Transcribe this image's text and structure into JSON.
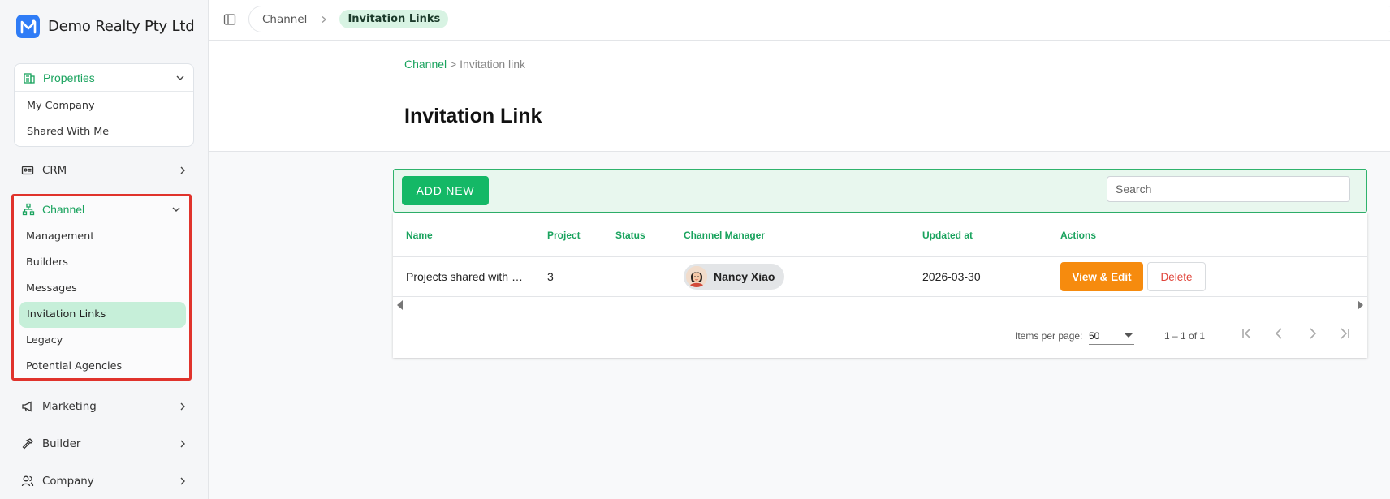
{
  "brand": {
    "name": "Demo Realty Pty Ltd",
    "logo_icon": "m-logo-icon",
    "logo_color": "#2f7cf6"
  },
  "sidebar": {
    "properties": {
      "label": "Properties",
      "items": [
        "My Company",
        "Shared With Me"
      ]
    },
    "crm": {
      "label": "CRM"
    },
    "channel": {
      "label": "Channel",
      "items": [
        "Management",
        "Builders",
        "Messages",
        "Invitation Links",
        "Legacy",
        "Potential Agencies"
      ],
      "active": "Invitation Links"
    },
    "marketing": {
      "label": "Marketing"
    },
    "builder": {
      "label": "Builder"
    },
    "company": {
      "label": "Company"
    }
  },
  "topbar": {
    "crumb_root": "Channel",
    "crumb_active": "Invitation Links"
  },
  "page": {
    "crumb_link": "Channel",
    "crumb_sep": " > ",
    "crumb_current": "Invitation link",
    "title": "Invitation Link"
  },
  "toolbar": {
    "add_label": "ADD NEW",
    "search_placeholder": "Search"
  },
  "table": {
    "columns": [
      "Name",
      "Project",
      "Status",
      "Channel Manager",
      "Updated at",
      "Actions"
    ],
    "rows": [
      {
        "name": "Projects shared with …",
        "project": "3",
        "status": "",
        "manager": "Nancy Xiao",
        "updated_at": "2026-03-30",
        "view_label": "View & Edit",
        "delete_label": "Delete"
      }
    ]
  },
  "paginator": {
    "items_per_page_label": "Items per page:",
    "items_per_page": "50",
    "range": "1 – 1 of 1"
  },
  "colors": {
    "accent_green": "#1aa35e",
    "add_button": "#14b866",
    "view_button": "#f68b0e",
    "delete_text": "#e0443a",
    "highlight_box": "#e0332c"
  }
}
